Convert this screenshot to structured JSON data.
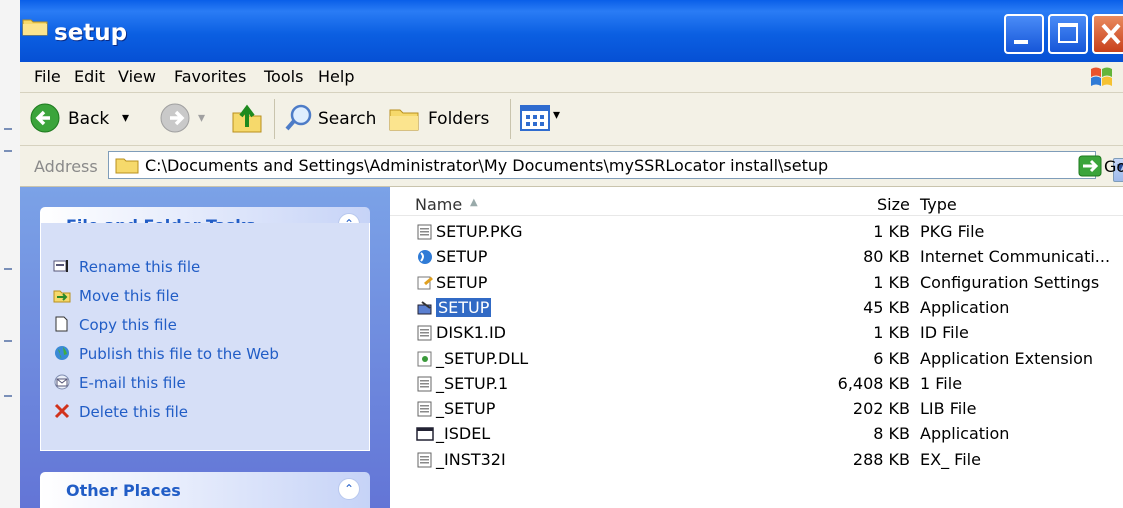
{
  "window": {
    "title": "setup",
    "minimize_label": "_",
    "maximize_label": "☐",
    "close_label": "✕"
  },
  "menu": [
    "File",
    "Edit",
    "View",
    "Favorites",
    "Tools",
    "Help"
  ],
  "toolbar": {
    "back_label": "Back",
    "back_arrow": "▾",
    "fwd_arrow": "▾",
    "search_label": "Search",
    "folders_label": "Folders",
    "views_arrow": "▾"
  },
  "address": {
    "label": "Address",
    "path": "C:\\Documents and Settings\\Administrator\\My Documents\\mySSRLocator install\\setup",
    "dropdown_glyph": "▾",
    "go_label": "Go"
  },
  "taskpane": {
    "file_tasks_title": "File and Folder Tasks",
    "toggle_glyph": "⌃",
    "tasks": [
      {
        "label": "Rename this file",
        "icon": "rename-icon"
      },
      {
        "label": "Move this file",
        "icon": "move-icon"
      },
      {
        "label": "Copy this file",
        "icon": "copy-icon"
      },
      {
        "label": "Publish this file to the Web",
        "icon": "globe-icon"
      },
      {
        "label": "E-mail this file",
        "icon": "email-icon"
      },
      {
        "label": "Delete this file",
        "icon": "delete-icon"
      }
    ],
    "other_places_title": "Other Places"
  },
  "filelist": {
    "headers": {
      "name": "Name",
      "sort_glyph": "▲",
      "size": "Size",
      "type": "Type"
    },
    "rows": [
      {
        "name": "SETUP.PKG",
        "size": "1 KB",
        "type": "PKG File",
        "icon": "generic-file-icon",
        "selected": false
      },
      {
        "name": "SETUP",
        "size": "80 KB",
        "type": "Internet Communicati...",
        "icon": "internet-shortcut-icon",
        "selected": false
      },
      {
        "name": "SETUP",
        "size": "1 KB",
        "type": "Configuration Settings",
        "icon": "config-file-icon",
        "selected": false
      },
      {
        "name": "SETUP",
        "size": "45 KB",
        "type": "Application",
        "icon": "installer-icon",
        "selected": true
      },
      {
        "name": "DISK1.ID",
        "size": "1 KB",
        "type": "ID File",
        "icon": "generic-file-icon",
        "selected": false
      },
      {
        "name": "_SETUP.DLL",
        "size": "6 KB",
        "type": "Application Extension",
        "icon": "dll-icon",
        "selected": false
      },
      {
        "name": "_SETUP.1",
        "size": "6,408 KB",
        "type": "1 File",
        "icon": "generic-file-icon",
        "selected": false
      },
      {
        "name": "_SETUP",
        "size": "202 KB",
        "type": "LIB File",
        "icon": "generic-file-icon",
        "selected": false
      },
      {
        "name": "_ISDEL",
        "size": "8 KB",
        "type": "Application",
        "icon": "app-window-icon",
        "selected": false
      },
      {
        "name": "_INST32I",
        "size": "288 KB",
        "type": "EX_ File",
        "icon": "generic-file-icon",
        "selected": false
      }
    ]
  },
  "colors": {
    "titlebar": "#0a5fe8",
    "taskpane": "#6f8fe0",
    "link": "#215dc6",
    "selection": "#316ac5"
  }
}
